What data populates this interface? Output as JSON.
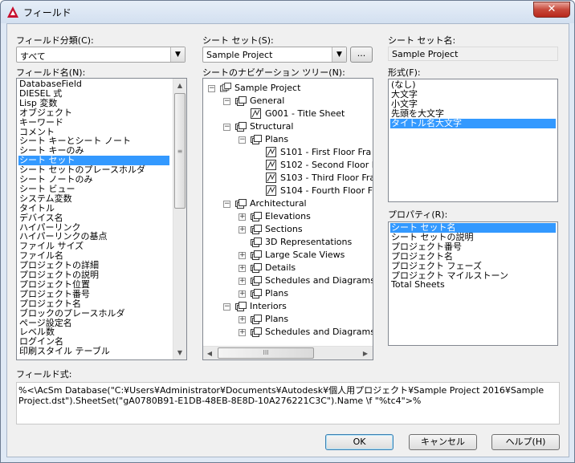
{
  "window": {
    "title": "フィールド",
    "close_label": "✕"
  },
  "category": {
    "label": "フィールド分類(C):",
    "value": "すべて"
  },
  "field_names": {
    "label": "フィールド名(N):",
    "items": [
      "DatabaseField",
      "DIESEL 式",
      "Lisp 変数",
      "オブジェクト",
      "キーワード",
      "コメント",
      "シート キーとシート ノート",
      "シート キーのみ",
      "シート セット",
      "シート セットのプレースホルダ",
      "シート ノートのみ",
      "シート ビュー",
      "システム変数",
      "タイトル",
      "デバイス名",
      "ハイパーリンク",
      "ハイパーリンクの基点",
      "ファイル サイズ",
      "ファイル名",
      "プロジェクトの詳細",
      "プロジェクトの説明",
      "プロジェクト位置",
      "プロジェクト番号",
      "プロジェクト名",
      "ブロックのプレースホルダ",
      "ページ設定名",
      "レベル数",
      "ログイン名",
      "印刷スタイル テーブル"
    ],
    "selected": "シート セット"
  },
  "sheet_set": {
    "label": "シート セット(S):",
    "value": "Sample Project",
    "browse_label": "..."
  },
  "sheet_set_name": {
    "label": "シート セット名:",
    "value": "Sample Project"
  },
  "nav_tree": {
    "label": "シートのナビゲーション ツリー(N):",
    "nodes": [
      {
        "text": "Sample Project",
        "level": 0,
        "icon": "sheet-set-icon",
        "expander": "−"
      },
      {
        "text": "General",
        "level": 1,
        "icon": "subset-folder-icon",
        "expander": "−"
      },
      {
        "text": "G001 - Title Sheet",
        "level": 2,
        "icon": "sheet-icon",
        "expander": ""
      },
      {
        "text": "Structural",
        "level": 1,
        "icon": "subset-folder-icon",
        "expander": "−"
      },
      {
        "text": "Plans",
        "level": 2,
        "icon": "subset-folder-icon",
        "expander": "−"
      },
      {
        "text": "S101 - First Floor Fra",
        "level": 3,
        "icon": "sheet-icon",
        "expander": ""
      },
      {
        "text": "S102 - Second Floor I",
        "level": 3,
        "icon": "sheet-icon",
        "expander": ""
      },
      {
        "text": "S103 - Third Floor Fra",
        "level": 3,
        "icon": "sheet-icon",
        "expander": ""
      },
      {
        "text": "S104 - Fourth Floor F",
        "level": 3,
        "icon": "sheet-icon",
        "expander": ""
      },
      {
        "text": "Architectural",
        "level": 1,
        "icon": "subset-folder-icon",
        "expander": "−"
      },
      {
        "text": "Elevations",
        "level": 2,
        "icon": "subset-folder-icon",
        "expander": "+"
      },
      {
        "text": "Sections",
        "level": 2,
        "icon": "subset-folder-icon",
        "expander": "+"
      },
      {
        "text": "3D Representations",
        "level": 2,
        "icon": "subset-folder-icon",
        "expander": ""
      },
      {
        "text": "Large Scale Views",
        "level": 2,
        "icon": "subset-folder-icon",
        "expander": "+"
      },
      {
        "text": "Details",
        "level": 2,
        "icon": "subset-folder-icon",
        "expander": "+"
      },
      {
        "text": "Schedules and Diagrams",
        "level": 2,
        "icon": "subset-folder-icon",
        "expander": "+"
      },
      {
        "text": "Plans",
        "level": 2,
        "icon": "subset-folder-icon",
        "expander": "+"
      },
      {
        "text": "Interiors",
        "level": 1,
        "icon": "subset-folder-icon",
        "expander": "−"
      },
      {
        "text": "Plans",
        "level": 2,
        "icon": "subset-folder-icon",
        "expander": "+"
      },
      {
        "text": "Schedules and Diagrams",
        "level": 2,
        "icon": "subset-folder-icon",
        "expander": "+"
      }
    ],
    "hscroll_grip": "III"
  },
  "format": {
    "label": "形式(F):",
    "items": [
      "(なし)",
      "大文字",
      "小文字",
      "先頭を大文字",
      "タイトル名大文字"
    ],
    "selected": "タイトル名大文字"
  },
  "properties": {
    "label": "プロパティ(R):",
    "items": [
      "シート セット名",
      "シート セットの説明",
      "プロジェクト番号",
      "プロジェクト名",
      "プロジェクト フェーズ",
      "プロジェクト マイルストーン",
      "Total Sheets"
    ],
    "selected": "シート セット名"
  },
  "field_expression": {
    "label": "フィールド式:",
    "value": "%<\\AcSm Database(\"C:¥Users¥Administrator¥Documents¥Autodesk¥個人用プロジェクト¥Sample Project 2016¥Sample Project.dst\").SheetSet(\"gA0780B91-E1DB-48EB-8E8D-10A276221C3C\").Name \\f \"%tc4\">%"
  },
  "buttons": {
    "ok": "OK",
    "cancel": "キャンセル",
    "help": "ヘルプ(H)"
  },
  "colors": {
    "selection": "#3399ff",
    "close_button": "#c7483a"
  }
}
